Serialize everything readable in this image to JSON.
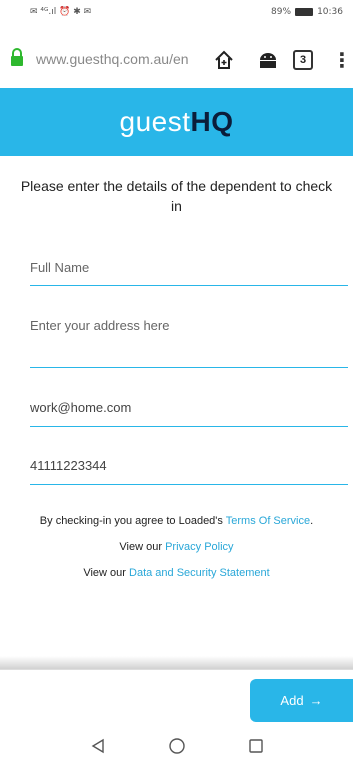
{
  "status_bar": {
    "left_icons": "✉ ⁴ᴳ.ıl ⏰ ✱ ✉",
    "battery": "89%",
    "time": "10:36"
  },
  "browser": {
    "url": "www.guesthq.com.au/en",
    "tab_count": "3"
  },
  "header": {
    "logo_main": "guest",
    "logo_accent": "HQ",
    "bg_color": "#29b6e8"
  },
  "intro": {
    "text": "Please enter the details of the dependent to check in"
  },
  "form": {
    "full_name": {
      "placeholder": "Full Name",
      "value": ""
    },
    "address": {
      "placeholder": "Enter your address here",
      "value": ""
    },
    "email": {
      "placeholder": "",
      "value": "work@home.com"
    },
    "phone": {
      "placeholder": "",
      "value": "41111223344"
    }
  },
  "terms": {
    "line1_prefix": "By checking-in you agree to Loaded's",
    "tos_link": "Terms Of Service",
    "line1_suffix": ".",
    "line2_prefix": "View our",
    "privacy_link": "Privacy Policy",
    "line3_prefix": "View our",
    "security_link": "Data and Security Statement"
  },
  "actions": {
    "add_label": "Add",
    "add_arrow": "→"
  },
  "icons": {
    "lock": "lock-icon",
    "home": "home-icon",
    "android": "android-icon",
    "tabs": "tabs-icon",
    "menu": "more-vert-icon",
    "back": "back-icon",
    "nav_home": "circle-home-icon",
    "recents": "recents-icon"
  }
}
